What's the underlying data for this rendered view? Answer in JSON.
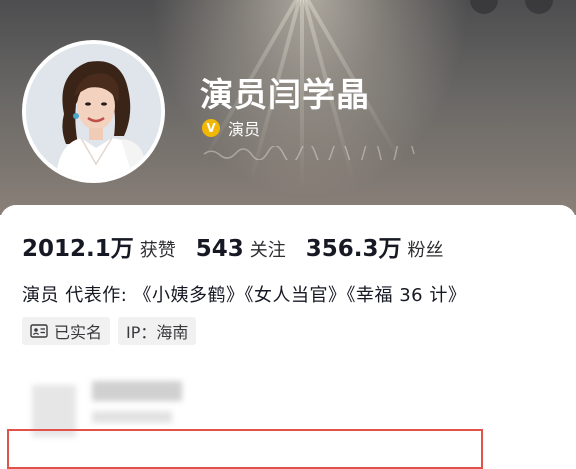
{
  "profile": {
    "name": "演员闫学晶",
    "verified_label": "演员",
    "verified_badge": "V"
  },
  "stats": [
    {
      "value": "2012.1万",
      "label": "获赞"
    },
    {
      "value": "543",
      "label": "关注"
    },
    {
      "value": "356.3万",
      "label": "粉丝"
    }
  ],
  "bio": "演员 代表作: 《小姨多鹤》《女人当官》《幸福 36 计》",
  "tags": [
    {
      "icon": "id-card-icon",
      "label": "已实名"
    },
    {
      "icon": "",
      "label": "IP：海南"
    }
  ],
  "colors": {
    "verified_badge": "#f2b705",
    "highlight_border": "#e0524a",
    "tag_background": "#f1f1f2"
  }
}
